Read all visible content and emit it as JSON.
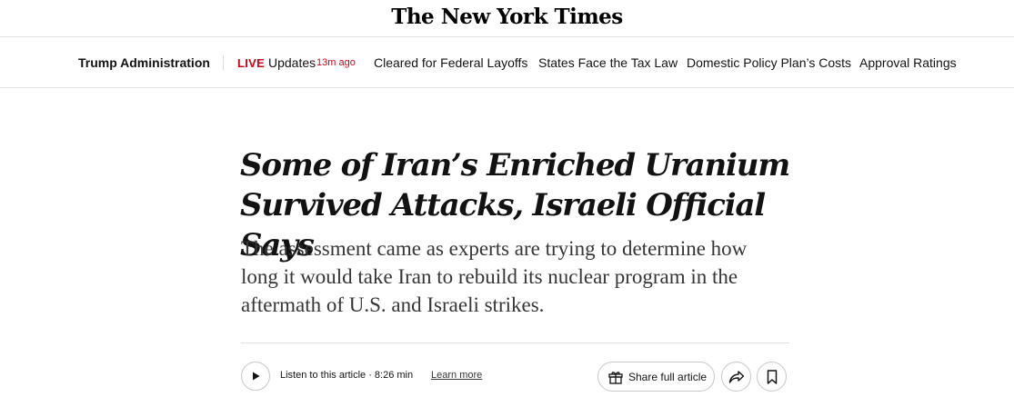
{
  "masthead": {
    "logo_text": "The New York Times"
  },
  "subnav": {
    "section_title": "Trump Administration",
    "live_label": "LIVE",
    "updates_label": "Updates",
    "updated_ago": "13m ago",
    "links": [
      "Cleared for Federal Layoffs",
      "States Face the Tax Law",
      "Domestic Policy Plan’s Costs",
      "Approval Ratings"
    ]
  },
  "article": {
    "headline": "Some of Iran’s Enriched Uranium Survived Attacks, Israeli Official Says",
    "summary": "The assessment came as experts are trying to determine how long it would take Iran to rebuild its nuclear program in the aftermath of U.S. and Israeli strikes."
  },
  "toolbar": {
    "listen_label": "Listen to this article · 8:26 min",
    "learn_more": "Learn more",
    "share_full_label": "Share full article",
    "icons": {
      "play": "play-icon",
      "gift": "gift-icon",
      "share": "share-arrow-icon",
      "bookmark": "bookmark-icon"
    }
  },
  "colors": {
    "live_red": "#d0021b",
    "text": "#121212",
    "border": "#c7c7c7"
  }
}
